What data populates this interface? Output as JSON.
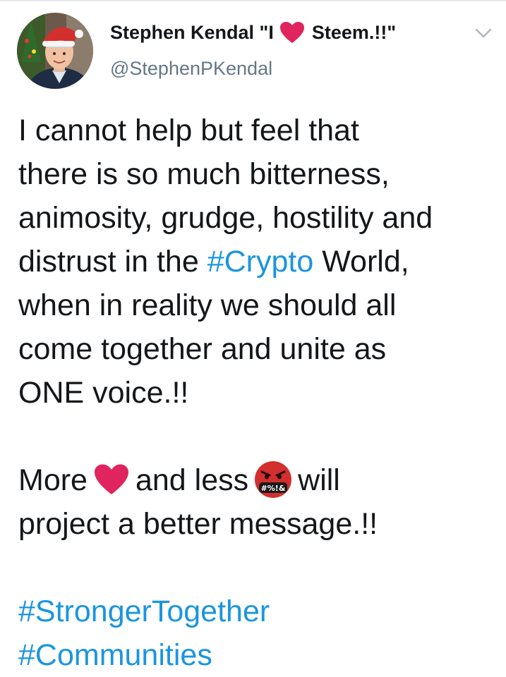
{
  "tweet": {
    "author": {
      "name_prefix": "Stephen Kendal \"I",
      "name_suffix": "Steem.!!\"",
      "handle": "@StephenPKendal"
    },
    "text": {
      "p1_line1": "I cannot help but feel that",
      "p1_line2": "there is so much bitterness,",
      "p1_line3": "animosity, grudge, hostility and",
      "p1_line4_before": "distrust in the",
      "p1_line4_hashtag": "#Crypto",
      "p1_line4_after": "World,",
      "p1_line5": "when in reality we should all",
      "p1_line6": "come together and unite as",
      "p1_line7": "ONE voice.!!",
      "p2_line1_a": "More",
      "p2_line1_b": "and less",
      "p2_line1_c": "will",
      "p2_line2": "project a better message.!!",
      "hashtag1": "#StrongerTogether",
      "hashtag2": "#Communities"
    },
    "emoji_text": {
      "angry_face_symbols": "#%!&"
    }
  },
  "colors": {
    "text": "#14171a",
    "secondary": "#657786",
    "hashtag": "#1b95e0",
    "heart": "#e0245e"
  },
  "icons": {
    "name_heart": "red-heart-icon",
    "caret": "chevron-down-icon",
    "heart_emoji": "red-heart-emoji",
    "angry_emoji": "face-with-symbols-on-mouth-emoji"
  }
}
